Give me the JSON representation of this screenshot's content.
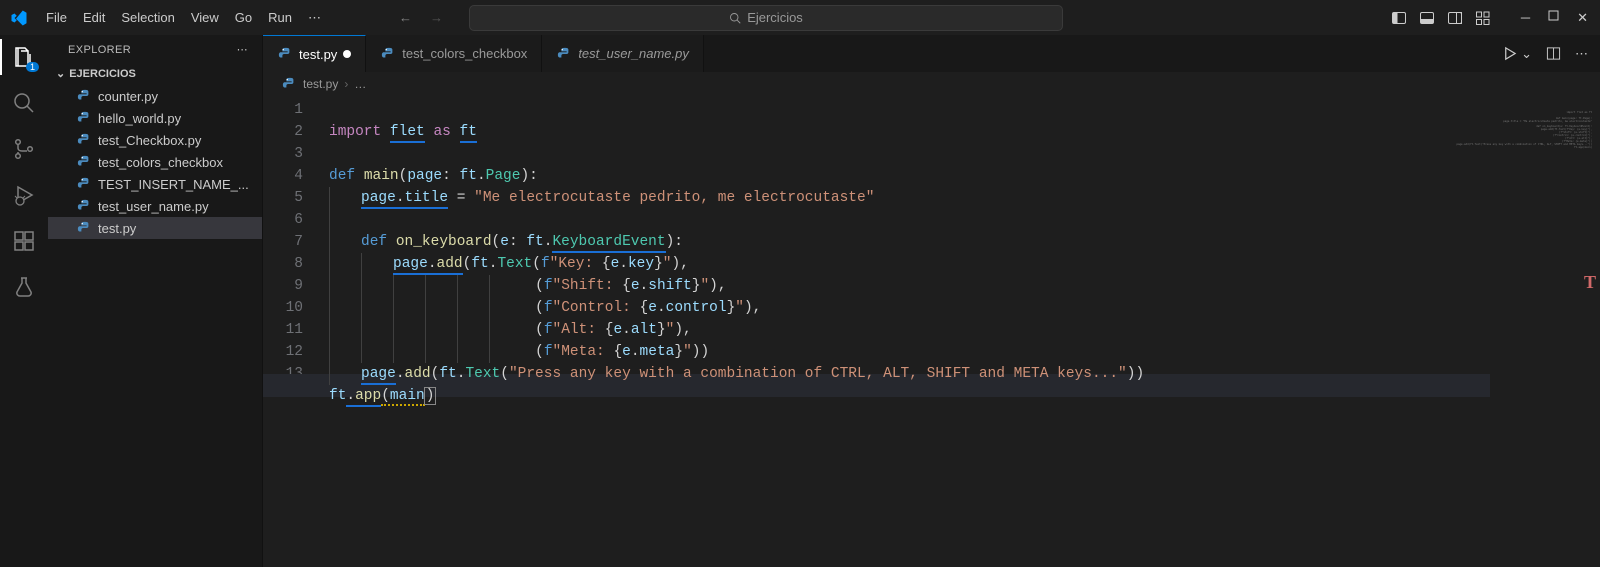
{
  "menu": {
    "file": "File",
    "edit": "Edit",
    "selection": "Selection",
    "view": "View",
    "go": "Go",
    "run": "Run"
  },
  "search_text": "Ejercicios",
  "activity_badge": "1",
  "sidebar": {
    "title": "EXPLORER",
    "folder": "EJERCICIOS",
    "files": [
      "counter.py",
      "hello_world.py",
      "test_Checkbox.py",
      "test_colors_checkbox",
      "TEST_INSERT_NAME_...",
      "test_user_name.py",
      "test.py"
    ]
  },
  "tabs": {
    "active": "test.py",
    "t2": "test_colors_checkbox",
    "t3": "test_user_name.py"
  },
  "breadcrumb": {
    "file": "test.py"
  },
  "code": {
    "l1_import": "import",
    "l1_flet": "flet",
    "l1_as": "as",
    "l1_ft": "ft",
    "l3_def": "def",
    "l3_main": "main",
    "l3_page": "page",
    "l3_Page": "Page",
    "l4_title": "title",
    "l4_str": "\"Me electrocutaste pedrito, me electrocutaste\"",
    "l6_def": "def",
    "l6_okb": "on_keyboard",
    "l6_e": "e",
    "l6_ke": "KeyboardEvent",
    "l7_add": "add",
    "l7_Text": "Text",
    "l7_f": "f",
    "l7_key_lit": "\"Key: ",
    "l7_key": "key",
    "l8_lit": "\"Shift: ",
    "l8_attr": "shift",
    "l9_lit": "\"Control: ",
    "l9_attr": "control",
    "l10_lit": "\"Alt: ",
    "l10_attr": "alt",
    "l11_lit": "\"Meta: ",
    "l11_attr": "meta",
    "l12_str": "\"Press any key with a combination of CTRL, ALT, SHIFT and META keys...\"",
    "l13_app": "app",
    "l13_main": "main"
  }
}
